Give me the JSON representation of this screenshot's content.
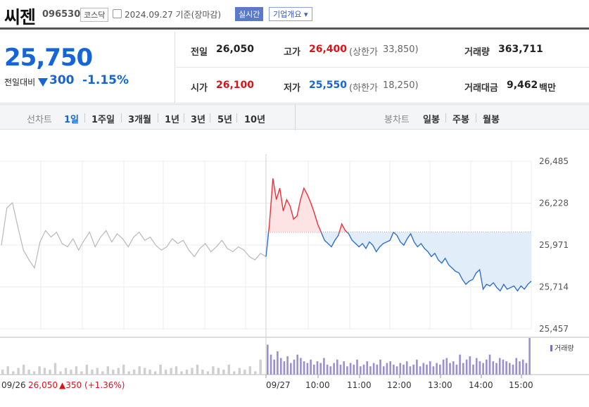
{
  "stock": {
    "name": "씨젠",
    "code": "096530",
    "market": "코스닥",
    "date": "2024.09.27 기준(장마감)",
    "realtime": "실시간",
    "overview": "기업개요",
    "overview_arrow": "▾"
  },
  "quote": {
    "price": "25,750",
    "change_label": "전일대비",
    "change": "300",
    "change_pct": "-1.15%",
    "direction": "down"
  },
  "stats": {
    "prev_label": "전일",
    "prev": "26,050",
    "high_label": "고가",
    "high": "26,400",
    "upper_label": "(상한가",
    "upper": "33,850)",
    "volume_label": "거래량",
    "volume": "363,711",
    "open_label": "시가",
    "open": "26,100",
    "low_label": "저가",
    "low": "25,550",
    "lower_label": "(하한가",
    "lower": "18,250)",
    "amount_label": "거래대금",
    "amount": "9,462",
    "amount_unit": "백만"
  },
  "tabs": {
    "line_label": "선차트",
    "line": [
      "1일",
      "1주일",
      "3개월",
      "1년",
      "3년",
      "5년",
      "10년"
    ],
    "active": "1일",
    "candle_label": "봉차트",
    "candle": [
      "일봉",
      "주봉",
      "월봉"
    ]
  },
  "colors": {
    "up": "#e8323a",
    "down": "#2f6fd0",
    "prev": "#bdbdbd",
    "up_fill": "#fde3e3",
    "down_fill": "#e2edfa"
  },
  "chart_data": {
    "type": "line",
    "y_ticks": [
      "26,485",
      "26,228",
      "25,971",
      "25,714",
      "25,457"
    ],
    "ylim": [
      25457,
      26485
    ],
    "reference": 26050,
    "x_ticks": [
      "09/27",
      "10:00",
      "11:00",
      "12:00",
      "13:00",
      "14:00",
      "15:00"
    ],
    "prev_day_label": "09/26",
    "prev_day_close": "26,050",
    "prev_day_change": "▲350 (+1.36%)",
    "volume_legend": "거래량",
    "prev_day_series": [
      25970,
      26200,
      26230,
      26080,
      25940,
      25880,
      25830,
      25990,
      26060,
      26020,
      26050,
      25980,
      25960,
      26010,
      25940,
      26000,
      26050,
      25960,
      26020,
      26060,
      25990,
      26040,
      26010,
      25960,
      26020,
      26050,
      26000,
      26020,
      25970,
      25940,
      25960,
      26010,
      25980,
      26000,
      25940,
      25900,
      25950,
      25980,
      25930,
      25960,
      26000,
      25950,
      25930,
      25960,
      25940,
      25900,
      25880,
      25920,
      25900
    ],
    "series": [
      {
        "time": "09:00",
        "price": 25900
      },
      {
        "time": "09:05",
        "price": 26100
      },
      {
        "time": "09:10",
        "price": 26380
      },
      {
        "time": "09:15",
        "price": 26250
      },
      {
        "time": "09:20",
        "price": 26320
      },
      {
        "time": "09:25",
        "price": 26180
      },
      {
        "time": "09:30",
        "price": 26250
      },
      {
        "time": "09:35",
        "price": 26210
      },
      {
        "time": "09:40",
        "price": 26130
      },
      {
        "time": "09:45",
        "price": 26150
      },
      {
        "time": "09:50",
        "price": 26250
      },
      {
        "time": "09:55",
        "price": 26320
      },
      {
        "time": "10:00",
        "price": 26280
      },
      {
        "time": "10:05",
        "price": 26230
      },
      {
        "time": "10:10",
        "price": 26170
      },
      {
        "time": "10:15",
        "price": 26100
      },
      {
        "time": "10:20",
        "price": 26050
      },
      {
        "time": "10:25",
        "price": 26000
      },
      {
        "time": "10:30",
        "price": 25980
      },
      {
        "time": "10:35",
        "price": 25960
      },
      {
        "time": "10:40",
        "price": 26000
      },
      {
        "time": "10:45",
        "price": 26030
      },
      {
        "time": "10:50",
        "price": 26100
      },
      {
        "time": "10:55",
        "price": 26060
      },
      {
        "time": "11:00",
        "price": 26040
      },
      {
        "time": "11:05",
        "price": 26000
      },
      {
        "time": "11:10",
        "price": 25980
      },
      {
        "time": "11:15",
        "price": 25960
      },
      {
        "time": "11:20",
        "price": 25980
      },
      {
        "time": "11:25",
        "price": 25950
      },
      {
        "time": "11:30",
        "price": 25990
      },
      {
        "time": "11:35",
        "price": 25970
      },
      {
        "time": "11:40",
        "price": 25930
      },
      {
        "time": "11:45",
        "price": 25960
      },
      {
        "time": "11:50",
        "price": 25980
      },
      {
        "time": "11:55",
        "price": 25990
      },
      {
        "time": "12:00",
        "price": 26000
      },
      {
        "time": "12:05",
        "price": 26050
      },
      {
        "time": "12:10",
        "price": 26030
      },
      {
        "time": "12:15",
        "price": 25990
      },
      {
        "time": "12:20",
        "price": 25970
      },
      {
        "time": "12:25",
        "price": 26010
      },
      {
        "time": "12:30",
        "price": 26040
      },
      {
        "time": "12:35",
        "price": 25990
      },
      {
        "time": "12:40",
        "price": 25960
      },
      {
        "time": "12:45",
        "price": 25980
      },
      {
        "time": "12:50",
        "price": 25950
      },
      {
        "time": "12:55",
        "price": 25930
      },
      {
        "time": "13:00",
        "price": 25900
      },
      {
        "time": "13:05",
        "price": 25920
      },
      {
        "time": "13:10",
        "price": 25880
      },
      {
        "time": "13:15",
        "price": 25860
      },
      {
        "time": "13:20",
        "price": 25890
      },
      {
        "time": "13:25",
        "price": 25850
      },
      {
        "time": "13:30",
        "price": 25830
      },
      {
        "time": "13:35",
        "price": 25810
      },
      {
        "time": "13:40",
        "price": 25800
      },
      {
        "time": "13:45",
        "price": 25760
      },
      {
        "time": "13:50",
        "price": 25730
      },
      {
        "time": "13:55",
        "price": 25750
      },
      {
        "time": "14:00",
        "price": 25760
      },
      {
        "time": "14:05",
        "price": 25800
      },
      {
        "time": "14:10",
        "price": 25820
      },
      {
        "time": "14:15",
        "price": 25700
      },
      {
        "time": "14:20",
        "price": 25730
      },
      {
        "time": "14:25",
        "price": 25720
      },
      {
        "time": "14:30",
        "price": 25740
      },
      {
        "time": "14:35",
        "price": 25710
      },
      {
        "time": "14:40",
        "price": 25690
      },
      {
        "time": "14:45",
        "price": 25730
      },
      {
        "time": "14:50",
        "price": 25700
      },
      {
        "time": "14:55",
        "price": 25710
      },
      {
        "time": "15:00",
        "price": 25720
      },
      {
        "time": "15:05",
        "price": 25690
      },
      {
        "time": "15:10",
        "price": 25720
      },
      {
        "time": "15:15",
        "price": 25700
      },
      {
        "time": "15:20",
        "price": 25730
      },
      {
        "time": "15:30",
        "price": 25750
      }
    ],
    "prev_day_volume": [
      3,
      5,
      2,
      4,
      6,
      3,
      2,
      5,
      4,
      3,
      7,
      2,
      4,
      3,
      5,
      2,
      6,
      3,
      4,
      2,
      5,
      3,
      4,
      6,
      2,
      3,
      5,
      4,
      3,
      2,
      6,
      3,
      4,
      5,
      2,
      3,
      4,
      6,
      3,
      2,
      5,
      4,
      3,
      6,
      2,
      4,
      3,
      5,
      2,
      9
    ],
    "volume": [
      18,
      12,
      9,
      14,
      10,
      8,
      11,
      7,
      9,
      12,
      10,
      8,
      7,
      9,
      6,
      8,
      7,
      10,
      6,
      5,
      7,
      9,
      6,
      8,
      5,
      7,
      6,
      9,
      5,
      6,
      8,
      5,
      7,
      6,
      9,
      5,
      7,
      8,
      6,
      5,
      7,
      6,
      8,
      5,
      6,
      9,
      5,
      7,
      6,
      8,
      5,
      7,
      6,
      9,
      10,
      7,
      8,
      6,
      12,
      7,
      9,
      11,
      6,
      10,
      8,
      7,
      9,
      12,
      8,
      7,
      10,
      9,
      8,
      7,
      6,
      10,
      8,
      9,
      7,
      22
    ]
  }
}
